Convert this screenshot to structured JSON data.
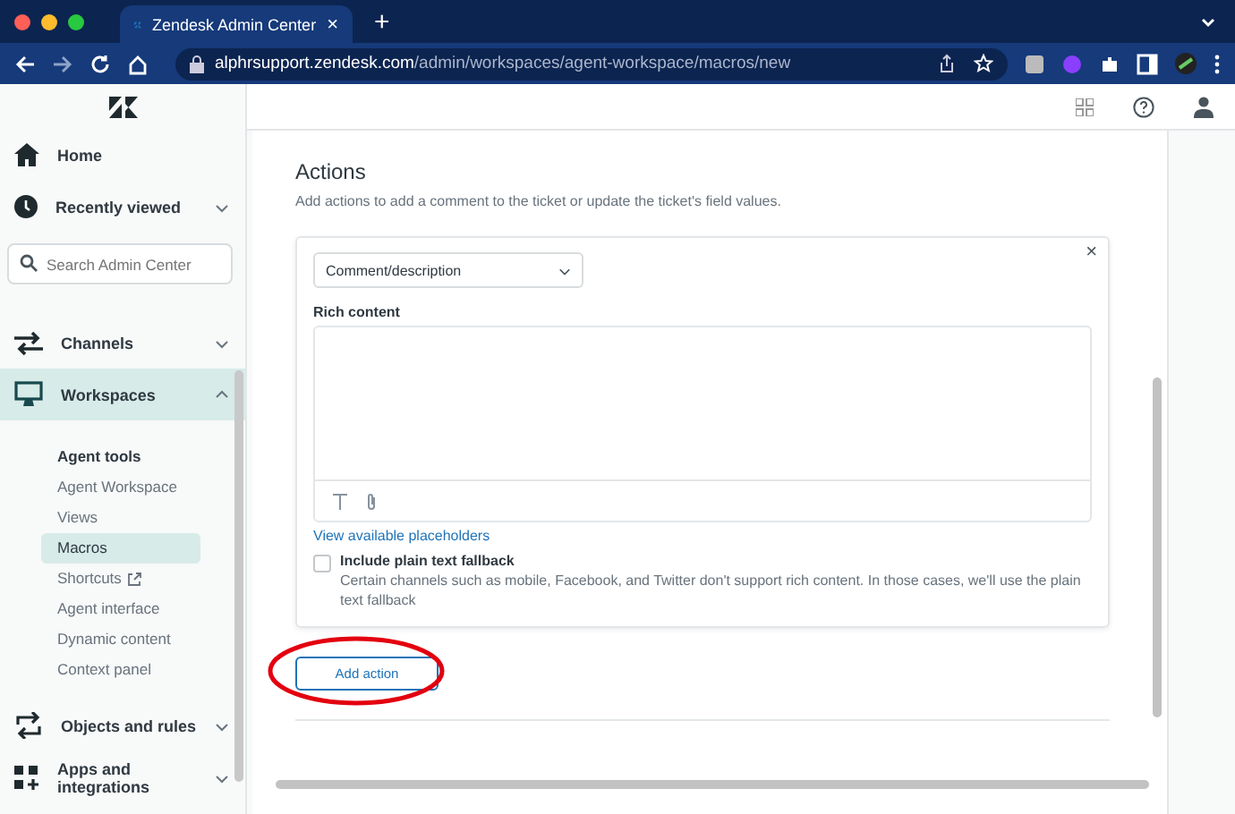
{
  "browser": {
    "tab_title": "Zendesk Admin Center",
    "tab_close": "×",
    "new_tab": "+",
    "url_host": "alphrsupport.zendesk.com",
    "url_path": "/admin/workspaces/agent-workspace/macros/new"
  },
  "sidebar": {
    "top_items": [
      {
        "label": "Home",
        "expandable": false
      },
      {
        "label": "Recently viewed",
        "expandable": true
      }
    ],
    "search": {
      "placeholder": "Search Admin Center"
    },
    "items": [
      {
        "label": "Channels",
        "expanded": false,
        "selected": false
      },
      {
        "label": "Workspaces",
        "expanded": true,
        "selected": true,
        "children": [
          {
            "label": "Agent tools",
            "kind": "heading"
          },
          {
            "label": "Agent Workspace",
            "kind": "link",
            "selected": false
          },
          {
            "label": "Views",
            "kind": "link",
            "selected": false
          },
          {
            "label": "Macros",
            "kind": "link",
            "selected": true
          },
          {
            "label": "Shortcuts",
            "kind": "external",
            "selected": false
          },
          {
            "label": "Agent interface",
            "kind": "link",
            "selected": false
          },
          {
            "label": "Dynamic content",
            "kind": "link",
            "selected": false
          },
          {
            "label": "Context panel",
            "kind": "link",
            "selected": false
          }
        ]
      },
      {
        "label": "Objects and rules",
        "expanded": false,
        "selected": false
      },
      {
        "label": "Apps and integrations",
        "expanded": false,
        "selected": false
      }
    ]
  },
  "actions": {
    "title": "Actions",
    "description": "Add actions to add a comment to the ticket or update the ticket's field values.",
    "card": {
      "close": "×",
      "dropdown": "Comment/description",
      "field_label": "Rich content",
      "link": "View available placeholders",
      "fallback": {
        "label": "Include plain text fallback",
        "checked": false,
        "hint": "Certain channels such as mobile, Facebook, and Twitter don't support rich content. In those cases, we'll use the plain text fallback"
      }
    },
    "add_button": "Add action",
    "highlighted": true
  }
}
